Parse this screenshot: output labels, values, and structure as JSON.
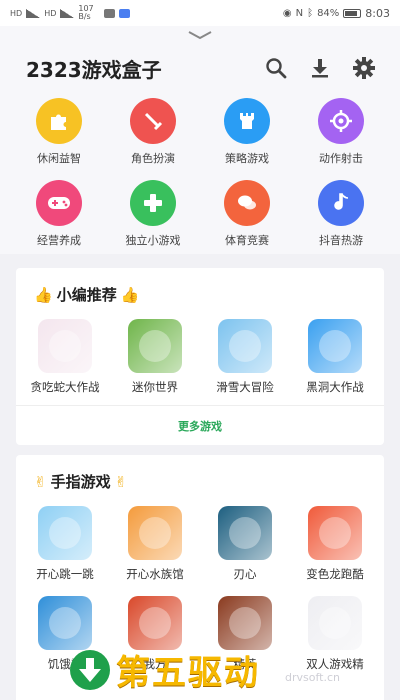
{
  "status_bar": {
    "left_labels": [
      "HD",
      "4G",
      "HD",
      "4G"
    ],
    "speed": "107 B/s",
    "battery": "84%",
    "battery_level": 0.84,
    "time": "8:03"
  },
  "header": {
    "title": "2323游戏盒子",
    "icons": [
      "search-icon",
      "download-icon",
      "gear-icon"
    ]
  },
  "categories": [
    {
      "label": "休闲益智",
      "color": "#f7c224",
      "icon": "puzzle-icon"
    },
    {
      "label": "角色扮演",
      "color": "#ef5350",
      "icon": "sword-icon"
    },
    {
      "label": "策略游戏",
      "color": "#2a9df4",
      "icon": "castle-icon"
    },
    {
      "label": "动作射击",
      "color": "#a463f2",
      "icon": "crosshair-icon"
    },
    {
      "label": "经营养成",
      "color": "#f0497b",
      "icon": "gamepad-icon"
    },
    {
      "label": "独立小游戏",
      "color": "#39c05d",
      "icon": "dpad-icon"
    },
    {
      "label": "体育竞赛",
      "color": "#f3643d",
      "icon": "chat-icon"
    },
    {
      "label": "抖音热游",
      "color": "#4a73f1",
      "icon": "music-icon"
    }
  ],
  "editor_picks": {
    "title": "小编推荐",
    "emoji": "👍",
    "games": [
      {
        "name": "贪吃蛇大作战",
        "color": "#f4e6ee"
      },
      {
        "name": "迷你世界",
        "color": "#6fb54a"
      },
      {
        "name": "滑雪大冒险",
        "color": "#7dc3ef"
      },
      {
        "name": "黑洞大作战",
        "color": "#3aa0f0"
      }
    ],
    "more_label": "更多游戏"
  },
  "finger_games": {
    "title": "手指游戏",
    "emoji": "✌",
    "games": [
      {
        "name": "开心跳一跳",
        "color": "#8fd0f4"
      },
      {
        "name": "开心水族馆",
        "color": "#f49b3c"
      },
      {
        "name": "刃心",
        "color": "#1d5f80"
      },
      {
        "name": "变色龙跑酷",
        "color": "#f05a3a"
      },
      {
        "name": "饥饿鲨",
        "color": "#2f8fd9"
      },
      {
        "name": "我方",
        "color": "#d9482a"
      },
      {
        "name": "精英",
        "color": "#8a3a1f"
      },
      {
        "name": "双人游戏精",
        "color": "#eeeef2"
      }
    ]
  },
  "watermark": {
    "text": "第五驱动",
    "url": "drvsoft.cn"
  }
}
